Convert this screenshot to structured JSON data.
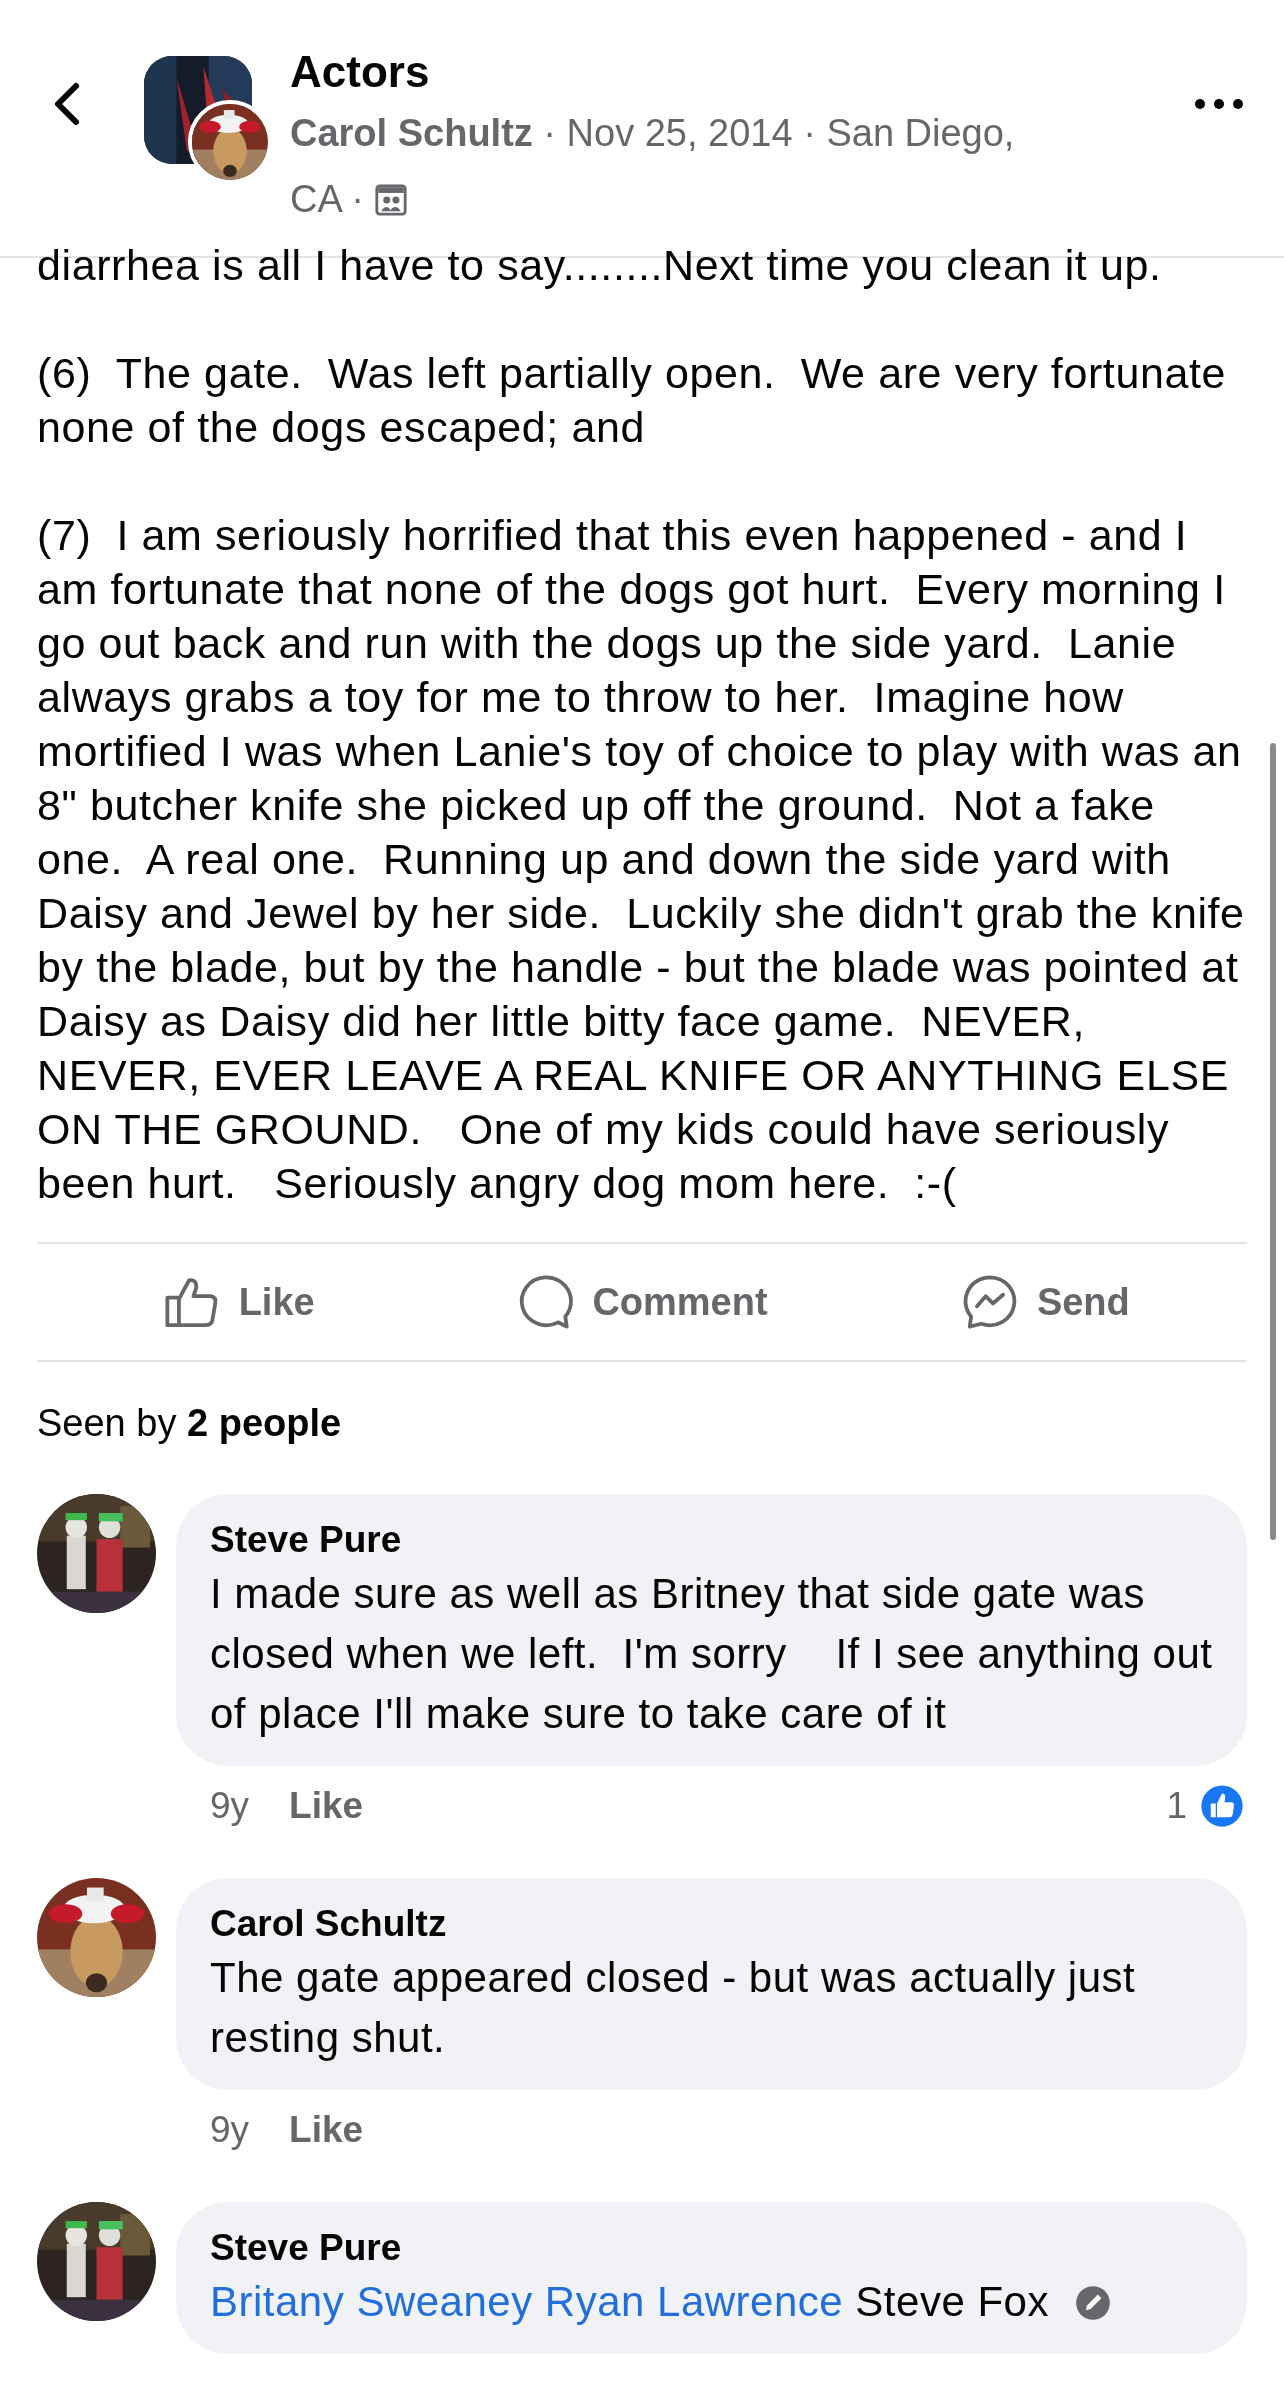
{
  "header": {
    "title": "Actors",
    "byline": "**Carol Schultz** · Nov 25, 2014 · San Diego, CA ·"
  },
  "post": {
    "paragraphs": [
      "diarrhea is all I have to say........Next time you clean it up.",
      "(6)  The gate.  Was left partially open.  We are very fortunate none of the dogs escaped; and",
      "(7)  I am seriously horrified that this even happened - and I am fortunate that none of the dogs got hurt.  Every morning I go out back and run with the dogs up the side yard.  Lanie always grabs a toy for me to throw to her.  Imagine how mortified I was when Lanie's toy of choice to play with was an 8\" butcher knife she picked up off the ground.  Not a fake one.  A real one.  Running up and down the side yard with Daisy and Jewel by her side.  Luckily she didn't grab the knife by the blade, but by the handle - but the blade was pointed at Daisy as Daisy did her little bitty face game.  NEVER, NEVER, EVER LEAVE A REAL KNIFE OR ANYTHING ELSE ON THE GROUND.   One of my kids could have seriously been hurt.   Seriously angry dog mom here.  :-("
    ]
  },
  "actions": [
    {
      "label": "Like",
      "kind": "like"
    },
    {
      "label": "Comment",
      "kind": "comment"
    },
    {
      "label": "Send",
      "kind": "send"
    }
  ],
  "seen_by": "Seen by **2 people**",
  "comments": [
    {
      "author": "Steve Pure",
      "segments": [
        {
          "text": "I made sure as well as Britney that side gate was closed when we left.  I'm sorry    If I see anything out of place I'll make sure to take care of it",
          "kind": "plain"
        }
      ],
      "age": "9y",
      "like": "Like",
      "reactions": "1",
      "edited": false
    },
    {
      "author": "Carol Schultz",
      "segments": [
        {
          "text": "The gate appeared closed - but was actually just resting shut.",
          "kind": "plain"
        }
      ],
      "age": "9y",
      "like": "Like",
      "edited": false
    },
    {
      "author": "Steve Pure",
      "segments": [
        {
          "text": "Britany Sweaney",
          "kind": "mention"
        },
        {
          "text": "Ryan Lawrence",
          "kind": "mention"
        },
        {
          "text": "Steve Fox",
          "kind": "plain"
        }
      ],
      "edited": true
    }
  ]
}
